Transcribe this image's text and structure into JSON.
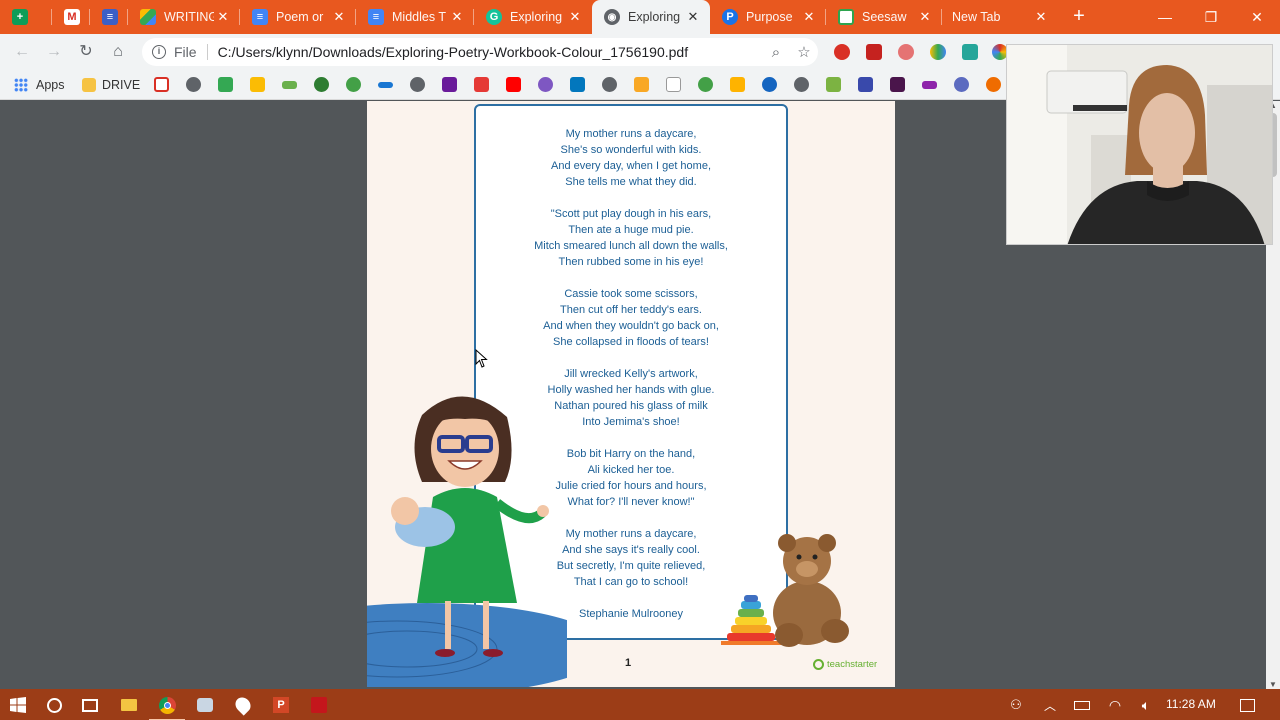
{
  "browser": {
    "tabs": [
      {
        "title": "",
        "favicon": "google-sheets-icon",
        "color": "#0f9d58"
      },
      {
        "title": "",
        "favicon": "gmail-icon",
        "color": "#d93025"
      },
      {
        "title": "",
        "favicon": "google-forms-icon",
        "color": "#3c5fc5"
      },
      {
        "title": "WRITING",
        "favicon": "google-drive-icon",
        "color": "#fbbc04"
      },
      {
        "title": "Poem or",
        "favicon": "google-docs-icon",
        "color": "#4285f4"
      },
      {
        "title": "Middles T",
        "favicon": "google-docs-icon",
        "color": "#4285f4"
      },
      {
        "title": "Exploring",
        "favicon": "grammarly-icon",
        "color": "#15c39a"
      },
      {
        "title": "Exploring",
        "favicon": "globe-icon",
        "color": "#5f6368"
      },
      {
        "title": "Purpose",
        "favicon": "purpose-icon",
        "color": "#1a73e8"
      },
      {
        "title": "Seesaw",
        "favicon": "seesaw-icon",
        "color": "#2ea44f"
      },
      {
        "title": "New Tab",
        "favicon": "",
        "color": ""
      }
    ],
    "active_tab_index": 7,
    "address": {
      "scheme": "File",
      "url": "C:/Users/klynn/Downloads/Exploring-Poetry-Workbook-Colour_1756190.pdf"
    },
    "bookmarks": {
      "apps_label": "Apps",
      "drive_label": "DRIVE"
    }
  },
  "pdf": {
    "poem_lines": [
      "My mother runs a daycare,",
      "She's so wonderful with kids.",
      "And every day, when I get home,",
      "She tells me what they did.",
      "",
      "\"Scott put play dough in his ears,",
      "Then ate a huge mud pie.",
      "Mitch smeared lunch all down the walls,",
      "Then rubbed some in his eye!",
      "",
      "Cassie took some scissors,",
      "Then cut off her teddy's ears.",
      "And when they wouldn't go back on,",
      "She collapsed in floods of tears!",
      "",
      "Jill wrecked Kelly's artwork,",
      "Holly washed her hands with glue.",
      "Nathan poured his glass of milk",
      "Into Jemima's shoe!",
      "",
      "Bob bit Harry on the hand,",
      "Ali kicked her toe.",
      "Julie cried for hours and hours,",
      "What for? I'll never know!\"",
      "",
      "My mother runs a daycare,",
      "And she says it's really cool.",
      "But secretly, I'm quite relieved,",
      "That I can go to school!",
      "",
      "Stephanie Mulrooney"
    ],
    "page_number": "1",
    "brand": "teachstarter"
  },
  "taskbar": {
    "time": "11:28 AM"
  },
  "colors": {
    "tabstrip": "#e8581f",
    "taskbar": "#9c3d17",
    "poem_text": "#1c5f95",
    "poem_border": "#2d6fa3",
    "page_bg": "#fbf3ed"
  }
}
